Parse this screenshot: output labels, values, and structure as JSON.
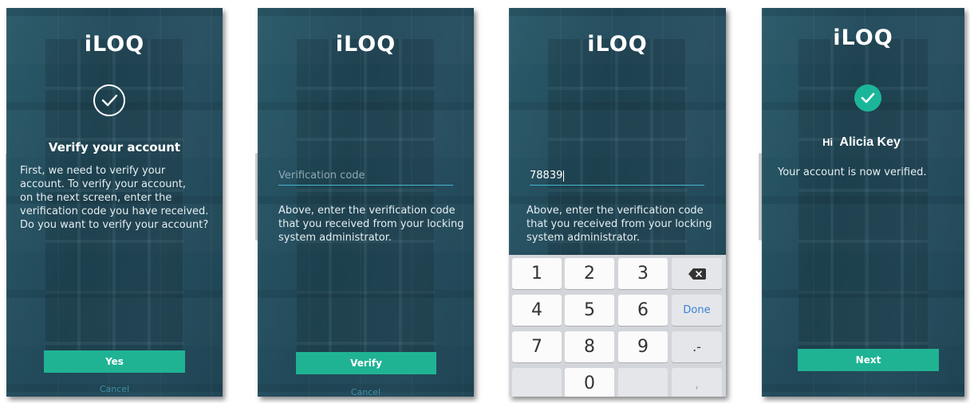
{
  "logo": "iLOQ",
  "screen1": {
    "title": "Verify your account",
    "body": [
      "First, we need to verify your",
      "account. To verify your account,",
      "on the next screen, enter the",
      "verification code you have received.",
      "Do you want to verify your account?"
    ],
    "yes_label": "Yes",
    "cancel_label": "Cancel"
  },
  "screen2": {
    "placeholder": "Verification code",
    "body": [
      "Above, enter the verification code",
      "that you received from your locking",
      "system administrator."
    ],
    "verify_label": "Verify",
    "cancel_label": "Cancel"
  },
  "screen3": {
    "code_value": "78839",
    "body": [
      "Above, enter the verification code",
      "that you received from your locking",
      "system administrator."
    ],
    "keys": {
      "k1": "1",
      "k2": "2",
      "k3": "3",
      "k4": "4",
      "k5": "5",
      "k6": "6",
      "k7": "7",
      "k8": "8",
      "k9": "9",
      "k0": "0",
      "done": "Done",
      "symbol": ".-",
      "comma": ","
    }
  },
  "screen4": {
    "greeting_prefix": "Hi",
    "greeting_name": "Alicia Key",
    "body": "Your account is now verified.",
    "next_label": "Next"
  },
  "colors": {
    "background": "#244b5b",
    "accent": "#1fb394",
    "input_underline": "#45b7cf"
  }
}
